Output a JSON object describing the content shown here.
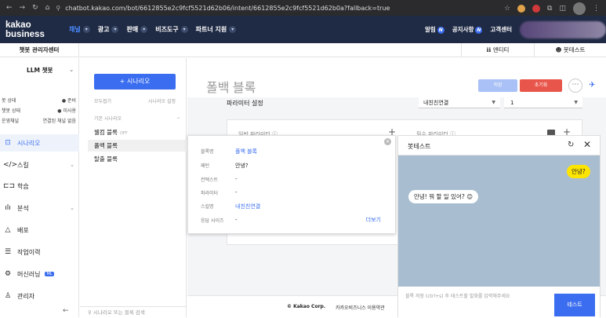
{
  "browser": {
    "url": "chatbot.kakao.com/bot/6612855e2c9fcf5521d62b06/intent/6612855e2c9fcf5521d62b0a?fallback=true"
  },
  "topbar": {
    "brand": "kakao business",
    "menu": [
      "채널",
      "광고",
      "판매",
      "비즈도구",
      "파트너 지원"
    ],
    "right": {
      "alarm": "알림",
      "notice": "공지사항",
      "center": "고객센터",
      "badge": "N"
    }
  },
  "subbar": {
    "title": "챗봇 관리자센터",
    "entity": "엔티티",
    "bot_test": "봇테스트"
  },
  "sidebar": {
    "bot_name": "LLM 챗봇",
    "status": [
      {
        "label": "봇 상태",
        "value": "● 준비"
      },
      {
        "label": "챗봇 상태",
        "value": "● 미사용"
      },
      {
        "label": "운영채널",
        "value": "연결된 채널 없음"
      }
    ],
    "items": [
      {
        "icon": "⊡",
        "label": "시나리오"
      },
      {
        "icon": "</>",
        "label": "스킬"
      },
      {
        "icon": "⊏⊐",
        "label": "학습"
      },
      {
        "icon": "ılı",
        "label": "분석"
      },
      {
        "icon": "△",
        "label": "배포"
      },
      {
        "icon": "☰",
        "label": "작업이력"
      },
      {
        "icon": "⚙",
        "label": "머신러닝"
      },
      {
        "icon": "♙",
        "label": "관리자"
      }
    ],
    "ml_badge": "ML",
    "collapse": "←"
  },
  "scenario_panel": {
    "add_button": "+ 시나리오",
    "collapse_all": "모두접기",
    "settings": "시나리오 설정",
    "section": "기본 시나리오",
    "blocks": [
      {
        "label": "웰컴 블록",
        "tag": "OFF"
      },
      {
        "label": "폴백 블록",
        "tag": ""
      },
      {
        "label": "탈출 블록",
        "tag": ""
      }
    ],
    "search_placeholder": "시나리오 또는 블록 검색"
  },
  "main": {
    "title": "폴백 블록",
    "save": "저장",
    "reset": "초기화",
    "param_settings": "파라미터 설정",
    "select1": "내친친연결",
    "select2": "1",
    "general_params": "일반 파라미터 ⓘ",
    "required_params": "필수 파라미터 ⓘ",
    "footer_corp": "© Kakao Corp.",
    "footer_policy": "카카오비즈니스 이용약관"
  },
  "popup": {
    "rows": [
      {
        "key": "블록명",
        "value": "폴백 블록",
        "link": true
      },
      {
        "key": "패턴",
        "value": "안녕?",
        "link": false
      },
      {
        "key": "컨텍스트",
        "value": "-",
        "link": false
      },
      {
        "key": "파라미터",
        "value": "-",
        "link": false
      },
      {
        "key": "스킬명",
        "value": "내친친연결",
        "link": true
      },
      {
        "key": "응답 사이즈",
        "value": "-",
        "link": false
      }
    ],
    "more": "더보기"
  },
  "bot_test": {
    "title": "봇테스트",
    "user_msg": "안녕?",
    "bot_msg": "안녕! 뭐 할 일 있어? 😊",
    "placeholder": "블록 저장 (ctrl+s) 후 테스트할 발화를 입력해주세요",
    "send": "테스트"
  },
  "colors": {
    "accent": "#3a6df0",
    "reset": "#e8554a",
    "header": "#1f2a44",
    "chat_bg": "#a9bdd0",
    "me_bubble": "#fee500"
  }
}
